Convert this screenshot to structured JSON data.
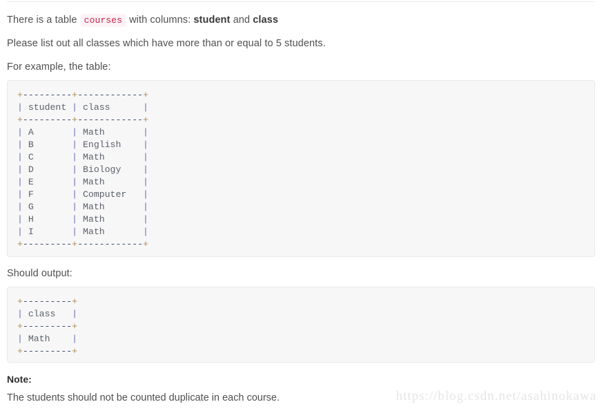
{
  "document": {
    "intro": {
      "prefix": "There is a table ",
      "table_name": "courses",
      "middle": " with columns: ",
      "column_1": "student",
      "conjunction": " and ",
      "column_2": "class"
    },
    "instruction": "Please list out all classes which have more than or equal to 5 students.",
    "example_label": "For example, the table:",
    "output_label": "Should output:",
    "note_heading": "Note:",
    "note_text": "The students should not be counted duplicate in each course.",
    "watermark": "https://blog.csdn.net/asahinokawa"
  },
  "input_table": {
    "border_top": "+---------+------------+",
    "header_row": "| student | class      |",
    "border_mid": "+---------+------------+",
    "rows": [
      "| A       | Math       |",
      "| B       | English    |",
      "| C       | Math       |",
      "| D       | Biology    |",
      "| E       | Math       |",
      "| F       | Computer   |",
      "| G       | Math       |",
      "| H       | Math       |",
      "| I       | Math       |"
    ],
    "border_bottom": "+---------+------------+",
    "columns": [
      "student",
      "class"
    ],
    "data": [
      [
        "A",
        "Math"
      ],
      [
        "B",
        "English"
      ],
      [
        "C",
        "Math"
      ],
      [
        "D",
        "Biology"
      ],
      [
        "E",
        "Math"
      ],
      [
        "F",
        "Computer"
      ],
      [
        "G",
        "Math"
      ],
      [
        "H",
        "Math"
      ],
      [
        "I",
        "Math"
      ]
    ],
    "text": "+---------+------------+\n| student | class      |\n+---------+------------+\n| A       | Math       |\n| B       | English    |\n| C       | Math       |\n| D       | Biology    |\n| E       | Math       |\n| F       | Computer   |\n| G       | Math       |\n| H       | Math       |\n| I       | Math       |\n+---------+------------+"
  },
  "output_table": {
    "border_top": "+---------+",
    "header_row": "| class   |",
    "border_mid": "+---------+",
    "rows": [
      "| Math    |"
    ],
    "border_bottom": "+---------+",
    "columns": [
      "class"
    ],
    "data": [
      [
        "Math"
      ]
    ],
    "text": "+---------+\n| class   |\n+---------+\n| Math    |\n+---------+"
  },
  "colors": {
    "inline_code_text": "#c7254e",
    "inline_code_bg": "#fdf2f5",
    "codeblock_bg": "#f7f7f8",
    "codeblock_border": "#e8e8e8",
    "body_text": "#4f4f4f",
    "watermark": "#e6e6e6"
  }
}
